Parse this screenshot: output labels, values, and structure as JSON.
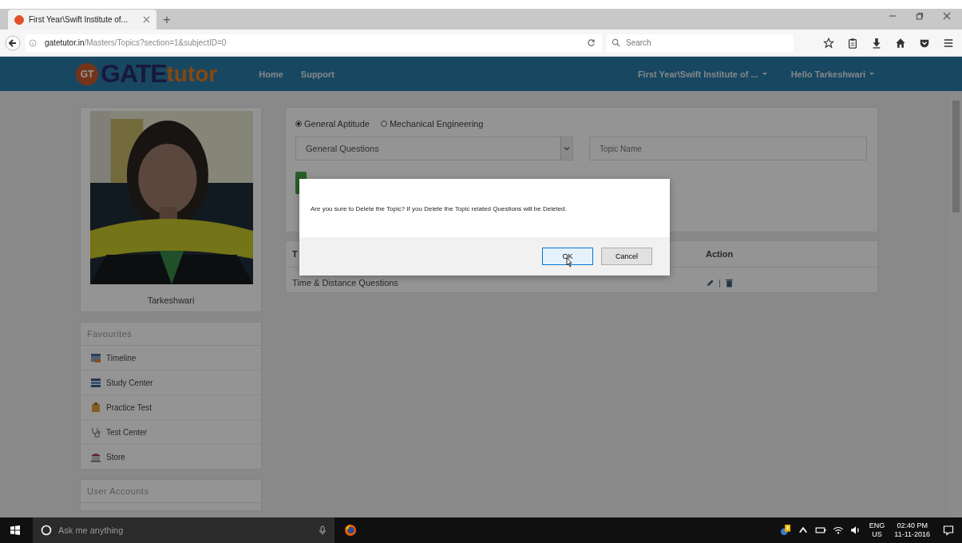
{
  "browser": {
    "tab_title": "First Year\\Swift Institute of...",
    "new_tab": "+",
    "url_host": "gatetutor.in",
    "url_path": "/Masters/Topics?section=1&subjectID=0",
    "search_placeholder": "Search"
  },
  "site": {
    "logo": {
      "badge": "GT",
      "word1": "GATE",
      "word2": "tutor"
    },
    "nav": [
      "Home",
      "Support"
    ],
    "menus": [
      {
        "label": "First Year\\Swift Institute of ..."
      },
      {
        "label": "Hello Tarkeshwari"
      }
    ]
  },
  "profile": {
    "name": "Tarkeshwari"
  },
  "favourites": {
    "title": "Favourites",
    "items": [
      {
        "label": "Timeline",
        "kind": "timeline"
      },
      {
        "label": "Study Center",
        "kind": "study"
      },
      {
        "label": "Practice Test",
        "kind": "practice"
      },
      {
        "label": "Test Center",
        "kind": "test"
      },
      {
        "label": "Store",
        "kind": "store"
      }
    ]
  },
  "user_accounts": {
    "title": "User Accounts"
  },
  "subjects": [
    {
      "label": "General Aptitude",
      "selected": true
    },
    {
      "label": "Mechanical Engineering",
      "selected": false
    }
  ],
  "category_select": {
    "value": "General Questions"
  },
  "topic_field": {
    "placeholder": "Topic Name"
  },
  "table": {
    "columns": [
      "T",
      "Action"
    ],
    "rows": [
      {
        "topic": "Time & Distance Questions"
      }
    ]
  },
  "dialog": {
    "message": "Are you sure to Delete the Topic? If you Delete the Topic related Questions will be Deleted.",
    "buttons": [
      {
        "label": "OK",
        "focused": true
      },
      {
        "label": "Cancel",
        "focused": false
      }
    ]
  },
  "taskbar": {
    "search_placeholder": "Ask me anything",
    "lang": "ENG",
    "region": "US",
    "time": "02:40 PM",
    "date": "11-11-2016"
  }
}
